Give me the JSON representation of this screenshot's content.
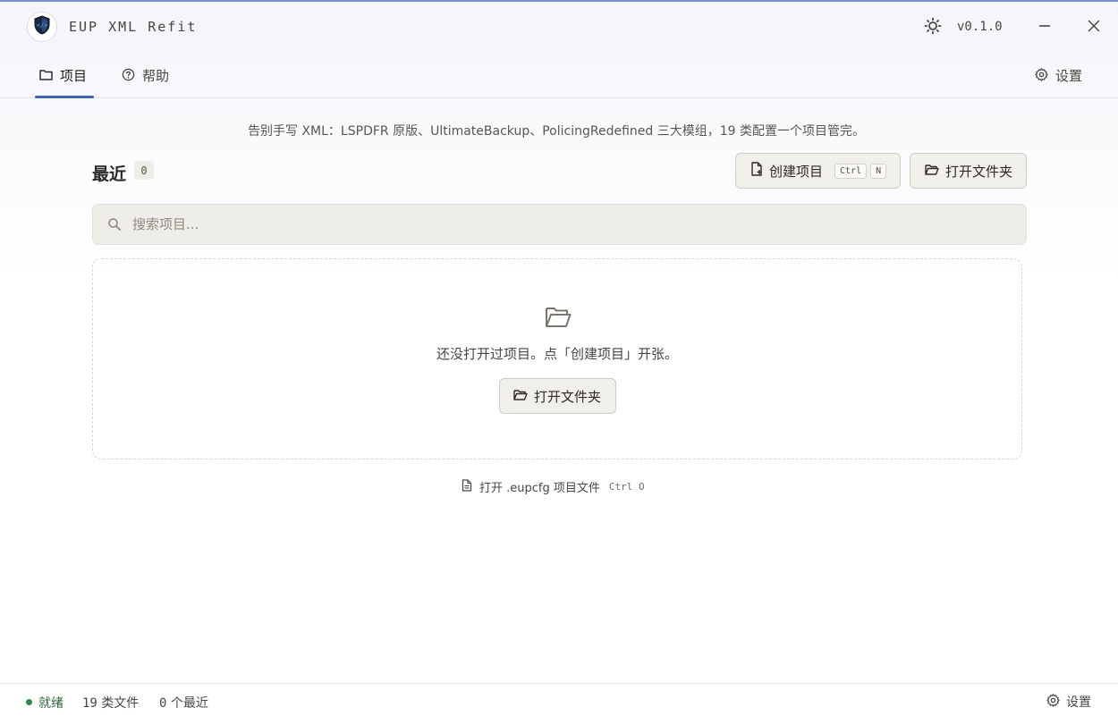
{
  "app": {
    "title": "EUP XML Refit",
    "version": "v0.1.0"
  },
  "tabs": {
    "projects": "项目",
    "help": "帮助",
    "settings": "设置"
  },
  "main": {
    "tagline": "告别手写 XML：LSPDFR 原版、UltimateBackup、PolicingRedefined 三大模组，19 类配置一个项目管完。",
    "recent_title": "最近",
    "recent_count": "0",
    "create_button": "创建项目",
    "create_shortcut": [
      "Ctrl",
      "N"
    ],
    "open_folder_button": "打开文件夹",
    "search_placeholder": "搜索项目...",
    "search_value": "",
    "empty_message": "还没打开过项目。点「创建项目」开张。",
    "empty_open_folder_button": "打开文件夹",
    "open_file_link": "打开 .eupcfg 项目文件",
    "open_file_shortcut": "Ctrl O"
  },
  "statusbar": {
    "status": "就绪",
    "file_count": "19",
    "file_label": "类文件",
    "recent_count": "0",
    "recent_label": "个最近",
    "settings": "设置",
    "status_color": "#2e8b4e"
  },
  "colors": {
    "accent": "#3a66b5",
    "button_bg": "#f1efea"
  },
  "icons": [
    "shield-logo-icon",
    "sun-icon",
    "minimize-icon",
    "close-icon",
    "folder-icon",
    "help-circle-icon",
    "gear-icon",
    "file-plus-icon",
    "folder-open-icon",
    "search-icon",
    "file-icon"
  ]
}
